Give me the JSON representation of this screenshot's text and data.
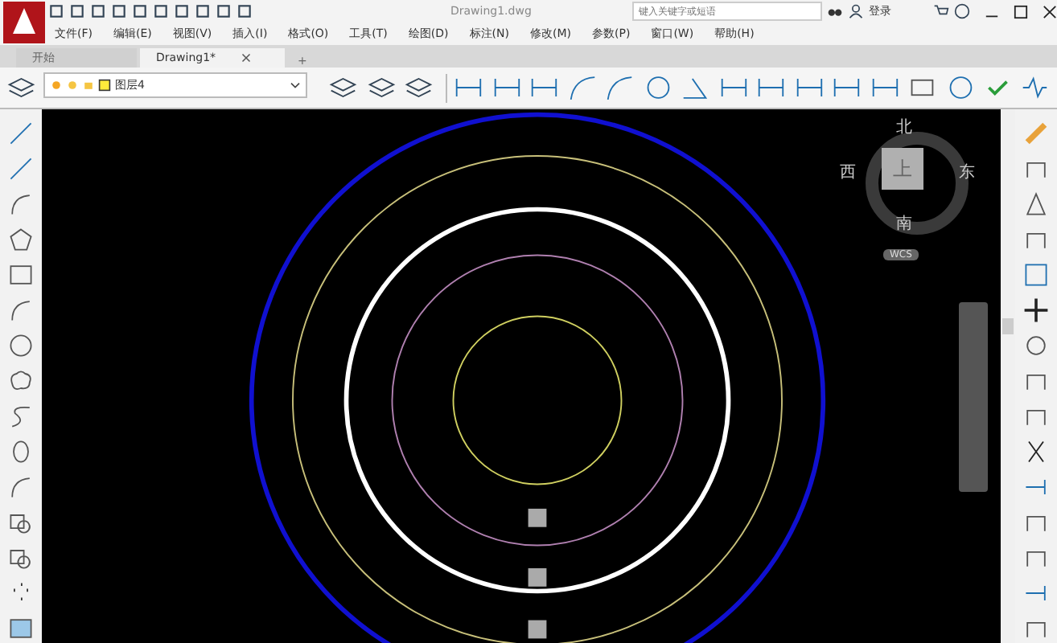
{
  "app": {
    "title": "Drawing1.dwg",
    "search_placeholder": "键入关键字或短语",
    "login": "登录"
  },
  "menu": [
    "文件(F)",
    "编辑(E)",
    "视图(V)",
    "插入(I)",
    "格式(O)",
    "工具(T)",
    "绘图(D)",
    "标注(N)",
    "修改(M)",
    "参数(P)",
    "窗口(W)",
    "帮助(H)"
  ],
  "tabs": [
    {
      "label": "开始",
      "selected": false,
      "closable": false
    },
    {
      "label": "Drawing1*",
      "selected": true,
      "closable": true
    }
  ],
  "new_tab": "+",
  "layer": {
    "name": "图层4"
  },
  "viewcube": {
    "north": "北",
    "south": "南",
    "east": "东",
    "west": "西",
    "face": "上",
    "ucs": "WCS"
  }
}
